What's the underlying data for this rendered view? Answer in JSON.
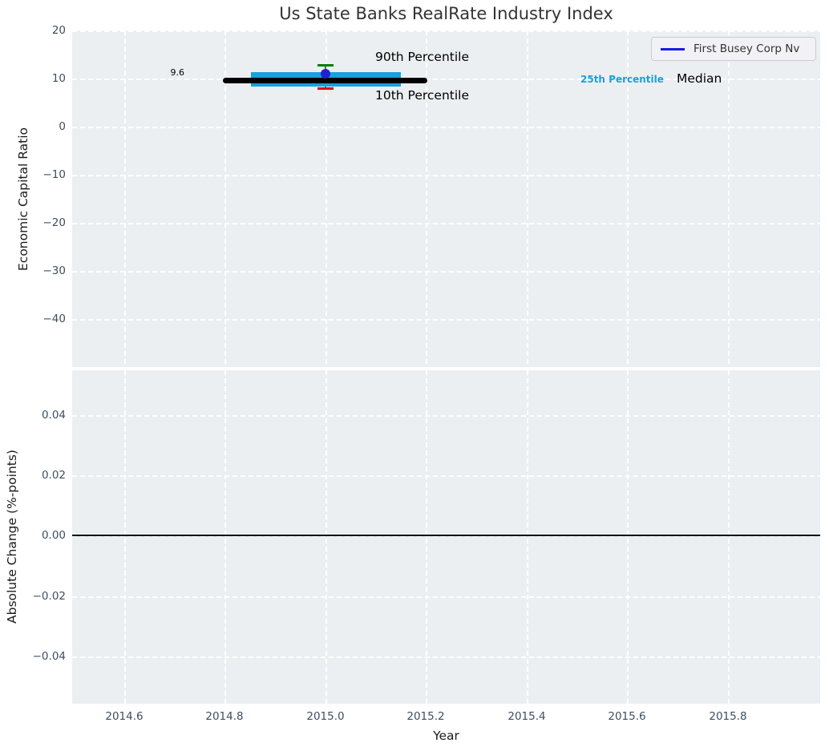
{
  "title": "Us State Banks RealRate Industry Index",
  "colors": {
    "plot_bg": "#eceff1",
    "grid": "#ffffff",
    "tick_label": "#3e4e60",
    "box": "#18a1da",
    "p90_cap": "#008000",
    "p10_cap": "#e10000",
    "median_line": "#000000",
    "company_point": "#2222cc",
    "legend_line": "#1a1ae8"
  },
  "chart_data": [
    {
      "type": "boxplot",
      "title": "Us State Banks RealRate Industry Index",
      "ylabel": "Economic Capital Ratio",
      "xlabel": "Year",
      "xlim": [
        2014.5,
        2015.98
      ],
      "ylim": [
        -50,
        20
      ],
      "xticks": [
        2014.6,
        2014.8,
        2015.0,
        2015.2,
        2015.4,
        2015.6,
        2015.8
      ],
      "yticks": [
        20,
        10,
        0,
        -10,
        -20,
        -30,
        -40
      ],
      "grid": "white-dashed",
      "legend": {
        "position": "upper right",
        "entries": [
          "First Busey Corp Nv"
        ]
      },
      "box": {
        "x_center": 2015.0,
        "p10": 8.0,
        "p25": 8.3,
        "median": 9.6,
        "p75": 11.3,
        "p90": 12.8,
        "box_x_range": [
          2014.85,
          2015.15
        ],
        "median_x_range": [
          2014.8,
          2015.2
        ]
      },
      "points": [
        {
          "name": "First Busey Corp Nv",
          "x": 2015.0,
          "y": 11.0
        }
      ],
      "annotations": [
        {
          "text": "9.6",
          "x": 2014.73,
          "y": 9.6
        },
        {
          "text": "90th Percentile",
          "x": 2015.1,
          "y": 14.5
        },
        {
          "text": "10th Percentile",
          "x": 2015.1,
          "y": 6.0
        },
        {
          "text": "25th Percentile",
          "x": 2015.52,
          "y": 9.6
        },
        {
          "text": "Median",
          "x": 2015.7,
          "y": 9.6
        }
      ]
    },
    {
      "type": "line",
      "ylabel": "Absolute Change (%-points)",
      "xlabel": "Year",
      "xlim": [
        2014.5,
        2015.98
      ],
      "ylim": [
        -0.056,
        0.055
      ],
      "xticks": [
        2014.6,
        2014.8,
        2015.0,
        2015.2,
        2015.4,
        2015.6,
        2015.8
      ],
      "yticks": [
        0.04,
        0.02,
        0.0,
        -0.02,
        -0.04
      ],
      "grid": "white-dashed",
      "zero_line": 0.0,
      "series": []
    }
  ],
  "ui": {
    "xlabel": "Year",
    "xticks": [
      "2014.6",
      "2014.8",
      "2015.0",
      "2015.2",
      "2015.4",
      "2015.6",
      "2015.8"
    ],
    "top": {
      "ylabel": "Economic Capital Ratio",
      "yticks": [
        "20",
        "10",
        "0",
        "−10",
        "−20",
        "−30",
        "−40"
      ],
      "legend_label": "First Busey Corp Nv",
      "ann_median_value": "9.6",
      "ann_p90": "90th Percentile",
      "ann_p10": "10th Percentile",
      "ann_p25": "25th Percentile",
      "ann_median": "Median"
    },
    "bottom": {
      "ylabel": "Absolute Change (%-points)",
      "yticks": [
        "0.04",
        "0.02",
        "0.00",
        "−0.02",
        "−0.04"
      ]
    }
  }
}
